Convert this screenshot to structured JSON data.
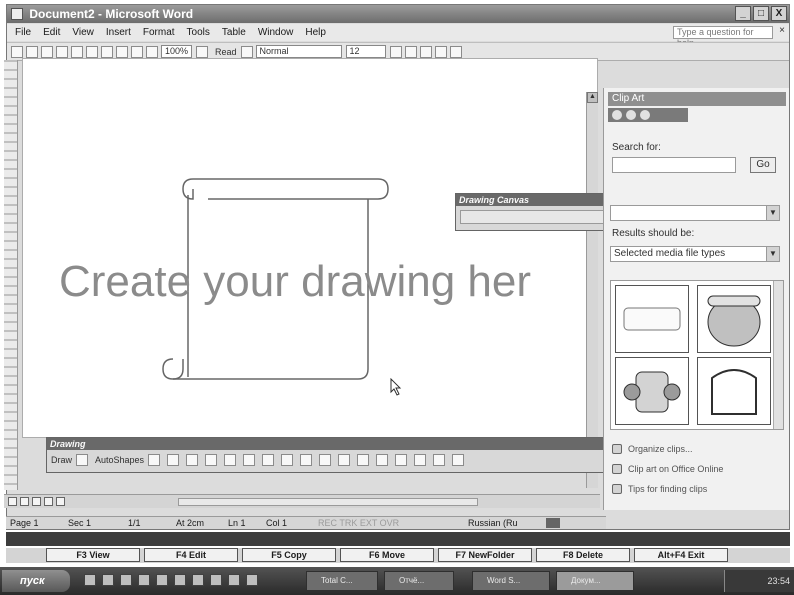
{
  "window": {
    "title": "Document2 - Microsoft Word",
    "controls": [
      "_",
      "□",
      "X"
    ]
  },
  "menu": {
    "items": [
      "File",
      "Edit",
      "View",
      "Insert",
      "Format",
      "Tools",
      "Table",
      "Window",
      "Help"
    ],
    "help_placeholder": "Type a question for help",
    "close": "×"
  },
  "toolbar": {
    "zoom": "100%",
    "read": "Read",
    "style": "Normal",
    "font_size": "12"
  },
  "canvas": {
    "text": "Create your drawing her"
  },
  "drawing_canvas_toolbar": {
    "title": "Drawing Canvas",
    "close": "×"
  },
  "drawing_toolbar": {
    "title": "Drawing",
    "draw": "Draw",
    "autoshapes": "AutoShapes",
    "close": "×"
  },
  "taskpane": {
    "title": "Clip Art",
    "search_for_label": "Search for:",
    "search_value": "",
    "go_label": "Go",
    "results_label": "Results should be:",
    "results_value": "Selected media file types",
    "links": [
      "Organize clips...",
      "Clip art on Office Online",
      "Tips for finding clips"
    ]
  },
  "statusbar": {
    "page": "Page 1",
    "sec": "Sec 1",
    "pages": "1/1",
    "at": "At 2cm",
    "ln": "Ln 1",
    "col": "Col 1",
    "flags": "REC  TRK  EXT  OVR",
    "lang": "Russian (Ru"
  },
  "fileman": {
    "note": "",
    "keys": [
      "F3 View",
      "F4 Edit",
      "F5 Copy",
      "F6 Move",
      "F7 NewFolder",
      "F8 Delete",
      "Alt+F4 Exit"
    ]
  },
  "taskbar": {
    "start": "пуск",
    "tasks": [
      "Total C...",
      "Отчё...",
      "Word S...",
      "Докум..."
    ],
    "clock": "23:54"
  }
}
